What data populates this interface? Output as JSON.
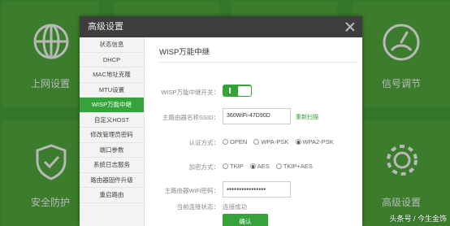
{
  "background": {
    "tiles": {
      "internet": "上网设置",
      "security": "安全防护",
      "signal": "信号调节",
      "advanced": "高级设置"
    }
  },
  "dialog": {
    "title": "高级设置",
    "sidebar": [
      {
        "label": "状态信息",
        "active": false
      },
      {
        "label": "DHCP",
        "active": false
      },
      {
        "label": "MAC地址克隆",
        "active": false
      },
      {
        "label": "MTU设置",
        "active": false
      },
      {
        "label": "WISP万能中继",
        "active": true
      },
      {
        "label": "自定义HOST",
        "active": false
      },
      {
        "label": "修改管理员密码",
        "active": false
      },
      {
        "label": "端口参数",
        "active": false
      },
      {
        "label": "系统日志服务",
        "active": false
      },
      {
        "label": "路由器固件升级",
        "active": false
      },
      {
        "label": "重启路由",
        "active": false
      }
    ],
    "content": {
      "title": "WISP万能中继",
      "switch_label": "WISP万能中继开关：",
      "ssid_label": "主路由器名称SSID：",
      "ssid_value": "360WiFi-47D90D",
      "rescan": "重新扫描",
      "auth_label": "认证方式：",
      "auth_options": [
        "OPEN",
        "WPA-PSK",
        "WPA2-PSK"
      ],
      "auth_selected": "WPA2-PSK",
      "enc_label": "加密方式：",
      "enc_options": [
        "TKIP",
        "AES",
        "TKIP+AES"
      ],
      "enc_selected": "AES",
      "pwd_label": "主路由器WiFi密码：",
      "pwd_value": "●●●●●●●●●●●●●●●●",
      "status_label": "当前连接状态：",
      "status_value": "连接成功",
      "confirm": "确认"
    }
  },
  "watermark": "头条号 / 今生金饰",
  "colors": {
    "accent": "#35a33a",
    "header": "#3d3d3d"
  }
}
